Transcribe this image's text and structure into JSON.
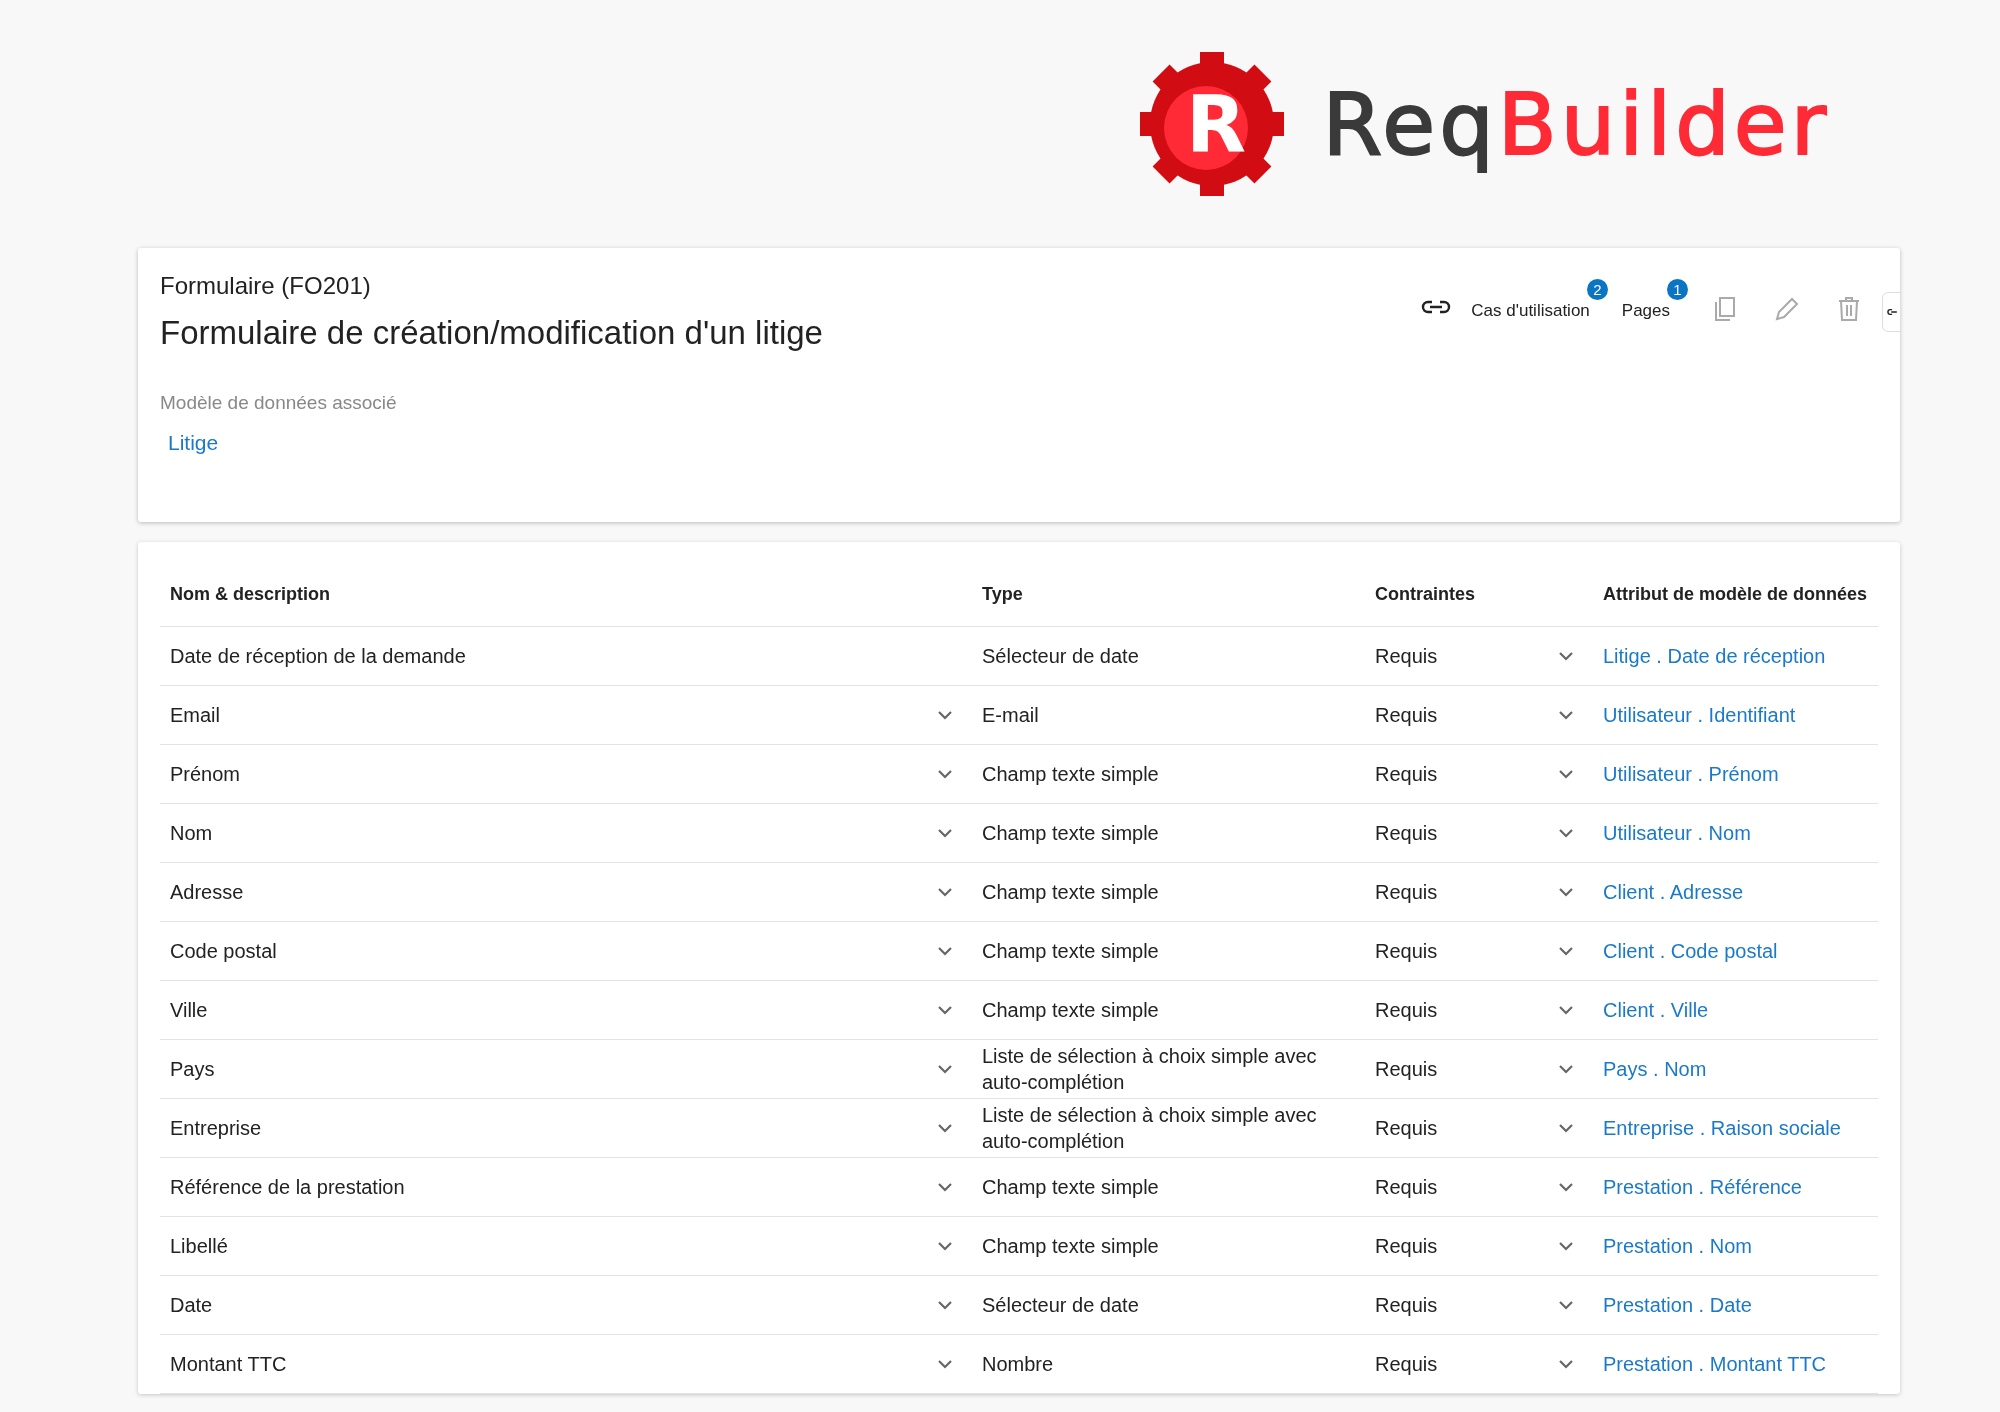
{
  "logo": {
    "initial": "R",
    "prefix": "Req",
    "suffix": "Builder"
  },
  "form": {
    "code": "Formulaire (FO201)",
    "title": "Formulaire de création/modification d'un litige",
    "data_model_label": "Modèle de données associé",
    "data_model": "Litige",
    "actions": [
      {
        "label": "Cas d'utilisation",
        "count": "2"
      },
      {
        "label": "Pages",
        "count": "1"
      }
    ]
  },
  "table": {
    "columns": [
      "Nom & description",
      "Type",
      "Contraintes",
      "Attribut de modèle de données"
    ],
    "rows": [
      {
        "name": "Date de réception de la demande",
        "expandable": false,
        "type": "Sélecteur de date",
        "constraint": "Requis",
        "attribute": "Litige . Date de réception"
      },
      {
        "name": "Email",
        "expandable": true,
        "type": "E-mail",
        "constraint": "Requis",
        "attribute": "Utilisateur . Identifiant"
      },
      {
        "name": "Prénom",
        "expandable": true,
        "type": "Champ texte simple",
        "constraint": "Requis",
        "attribute": "Utilisateur . Prénom"
      },
      {
        "name": "Nom",
        "expandable": true,
        "type": "Champ texte simple",
        "constraint": "Requis",
        "attribute": "Utilisateur . Nom"
      },
      {
        "name": "Adresse",
        "expandable": true,
        "type": "Champ texte simple",
        "constraint": "Requis",
        "attribute": "Client . Adresse"
      },
      {
        "name": "Code postal",
        "expandable": true,
        "type": "Champ texte simple",
        "constraint": "Requis",
        "attribute": "Client . Code postal"
      },
      {
        "name": "Ville",
        "expandable": true,
        "type": "Champ texte simple",
        "constraint": "Requis",
        "attribute": "Client . Ville"
      },
      {
        "name": "Pays",
        "expandable": true,
        "type": "Liste de sélection à choix simple avec auto-complétion",
        "constraint": "Requis",
        "attribute": "Pays . Nom"
      },
      {
        "name": "Entreprise",
        "expandable": true,
        "type": "Liste de sélection à choix simple avec auto-complétion",
        "constraint": "Requis",
        "attribute": "Entreprise . Raison sociale"
      },
      {
        "name": "Référence de la prestation",
        "expandable": true,
        "type": "Champ texte simple",
        "constraint": "Requis",
        "attribute": "Prestation . Référence"
      },
      {
        "name": "Libellé",
        "expandable": true,
        "type": "Champ texte simple",
        "constraint": "Requis",
        "attribute": "Prestation . Nom"
      },
      {
        "name": "Date",
        "expandable": true,
        "type": "Sélecteur de date",
        "constraint": "Requis",
        "attribute": "Prestation . Date"
      },
      {
        "name": "Montant TTC",
        "expandable": true,
        "type": "Nombre",
        "constraint": "Requis",
        "attribute": "Prestation . Montant TTC"
      }
    ]
  }
}
